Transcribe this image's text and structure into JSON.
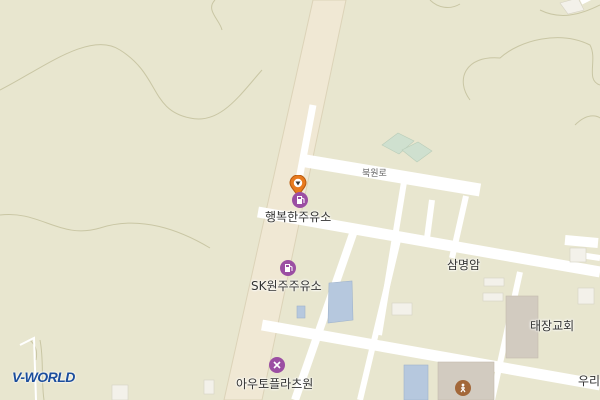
{
  "brand": {
    "logo_text": "V-WORLD"
  },
  "labels": {
    "selected_poi": "행복한주유소",
    "gas_station": "SK원주주유소",
    "auto_shop": "아우토플라츠원",
    "area": "삼명암",
    "church": "태장교회",
    "partial": "우리",
    "road": "북원로"
  },
  "icons": {
    "selected_marker": "location-pin-icon",
    "fuel_pump_selected": "fuel-pump-icon",
    "fuel_pump": "fuel-pump-icon",
    "auto_repair": "wrench-screwdriver-icon",
    "church": "church-icon"
  },
  "colors": {
    "land": "#e8e6cf",
    "road_main": "#f0e8d4",
    "road_minor": "#ffffff",
    "poi_purple": "#9b4ea3",
    "marker_orange": "#e87a1e",
    "church_brown": "#a3683a",
    "logo_blue": "#1b4d9c"
  }
}
